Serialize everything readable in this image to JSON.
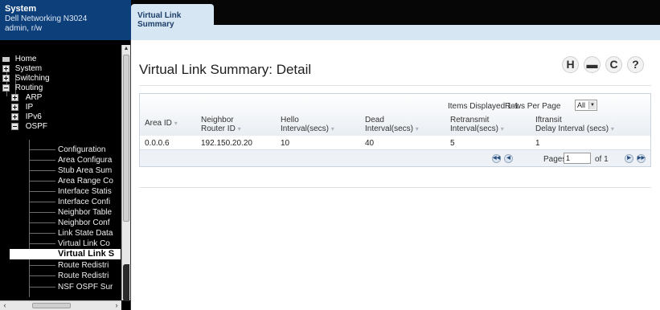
{
  "system_header": {
    "title": "System",
    "model": "Dell Networking N3024",
    "user": "admin, r/w"
  },
  "nav_tree": {
    "home": "Home",
    "system": "System",
    "switching": "Switching",
    "routing": "Routing",
    "arp": "ARP",
    "ip": "IP",
    "ipv6": "IPv6",
    "ospf": "OSPF",
    "ospf_items": [
      "Configuration",
      "Area Configura",
      "Stub Area Sum",
      "Area Range Co",
      "Interface Statis",
      "Interface Confi",
      "Neighbor Table",
      "Neighbor Conf",
      "Link State Data",
      "Virtual Link Co",
      "Virtual Link S",
      "Route Redistri",
      "Route Redistri",
      "NSF OSPF Sur"
    ],
    "selected_index": 10
  },
  "tabs": {
    "active": "Virtual Link Summary"
  },
  "page": {
    "title": "Virtual Link Summary: Detail"
  },
  "toolbar_icons": [
    "help-save-icon",
    "print-icon",
    "refresh-icon",
    "help-icon"
  ],
  "toolbar_glyphs": {
    "save": "H",
    "print": "▬",
    "refresh": "C",
    "help": "?"
  },
  "grid": {
    "items_displayed": "Items Displayed 1-1",
    "rows_per_page_label": "Rows Per Page",
    "rows_per_page_value": "All",
    "columns": [
      {
        "line1": "Area ID",
        "line2": ""
      },
      {
        "line1": "Neighbor",
        "line2": "Router ID"
      },
      {
        "line1": "Hello",
        "line2": "Interval(secs)"
      },
      {
        "line1": "Dead",
        "line2": "Interval(secs)"
      },
      {
        "line1": "Retransmit",
        "line2": "Interval(secs)"
      },
      {
        "line1": "Iftransit",
        "line2": "Delay Interval (secs)"
      }
    ],
    "rows": [
      [
        "0.0.0.6",
        "192.150.20.20",
        "10",
        "40",
        "5",
        "1"
      ]
    ],
    "pages_label": "Pages",
    "page_value": "1",
    "page_of": "of 1"
  }
}
